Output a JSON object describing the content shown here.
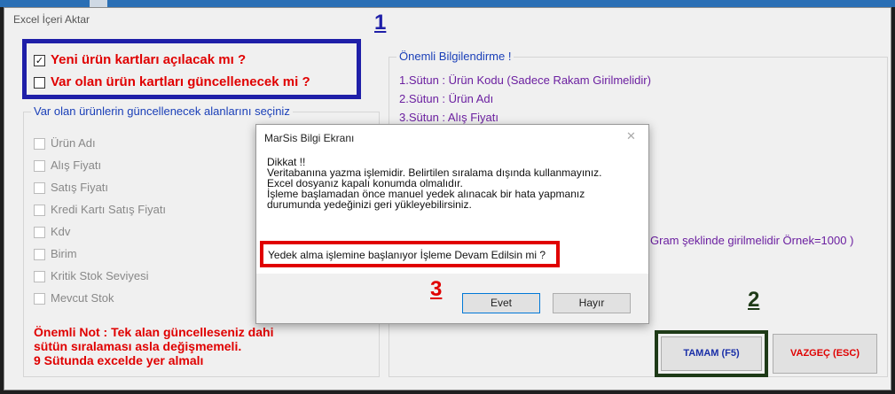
{
  "window": {
    "title": "Excel İçeri Aktar"
  },
  "annotations": {
    "n1": "1",
    "n2": "2",
    "n3": "3"
  },
  "options": {
    "new_cards": {
      "label": "Yeni ürün kartları açılacak mı ?",
      "checked": true
    },
    "update_cards": {
      "label": "Var olan ürün kartları güncellenecek mi ?",
      "checked": false
    }
  },
  "fields_group": {
    "legend": "Var olan ürünlerin güncellenecek alanlarını seçiniz",
    "items": [
      "Ürün Adı",
      "Alış Fiyatı",
      "Satış Fiyatı",
      "Kredi Kartı Satış Fiyatı",
      "Kdv",
      "Birim",
      "Kritik Stok Seviyesi",
      "Mevcut Stok"
    ]
  },
  "note": {
    "line1": "Önemli Not : Tek alan güncelleseniz dahi",
    "line2": "sütün sıralaması asla değişmemeli.",
    "line3": "9 Sütunda excelde yer almalı"
  },
  "info": {
    "legend": "Önemli Bilgilendirme !",
    "line1": "1.Sütun : Ürün Kodu (Sadece Rakam Girilmelidir)",
    "line2": "2.Sütun : Ürün Adı",
    "line3": "3.Sütun : Alış Fiyatı",
    "partial": "Gram şeklinde girilmelidir Örnek=1000 )"
  },
  "buttons": {
    "ok": "TAMAM (F5)",
    "cancel": "VAZGEÇ (ESC)"
  },
  "dialog": {
    "title": "MarSis Bilgi Ekranı",
    "close": "✕",
    "message": {
      "l1": "Dikkat !!",
      "l2": "Veritabanına yazma işlemidir. Belirtilen sıralama dışında kullanmayınız.",
      "l3": "Excel dosyanız kapalı konumda olmalıdır.",
      "l4": "İşleme başlamadan önce manuel yedek alınacak bir hata yapmanız",
      "l5": "durumunda yedeğinizi geri yükleyebilirsiniz."
    },
    "question": "Yedek alma işlemine başlanıyor İşleme Devam Edilsin mi ?",
    "yes": "Evet",
    "no": "Hayır"
  },
  "colors": {
    "annotation_blue": "#1f1fa8",
    "annotation_green": "#1e3a17",
    "annotation_red": "#e00000",
    "info_purple": "#6b1fa0"
  }
}
